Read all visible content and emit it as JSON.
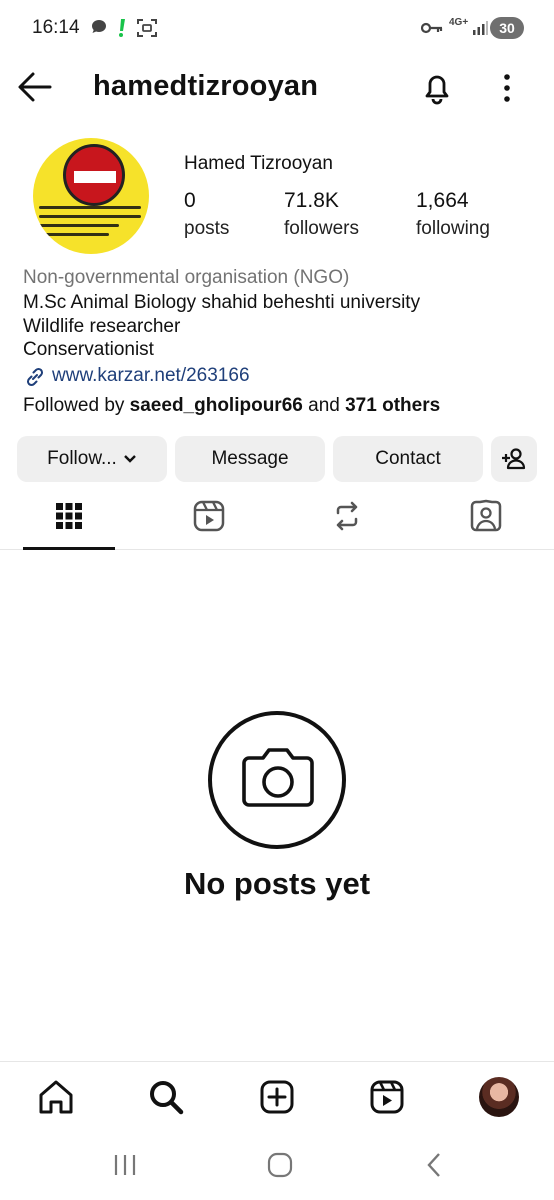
{
  "status_bar": {
    "time": "16:14",
    "network": "4G+",
    "battery": "30",
    "icons": [
      "chat-bubble-icon",
      "alert-icon",
      "screen-record-icon",
      "vpn-key-icon",
      "signal-icon"
    ]
  },
  "header": {
    "username": "hamedtizrooyan",
    "back_icon": "arrow-left-icon",
    "bell_icon": "bell-icon",
    "more_icon": "more-vertical-icon"
  },
  "profile": {
    "display_name": "Hamed Tizrooyan",
    "stats": [
      {
        "value": "0",
        "label": "posts"
      },
      {
        "value": "71.8K",
        "label": "followers"
      },
      {
        "value": "1,664",
        "label": "following"
      }
    ],
    "category": "Non-governmental organisation (NGO)",
    "bio": [
      "M.Sc Animal Biology shahid beheshti university",
      "Wildlife researcher",
      "Conservationist"
    ],
    "link": "www.karzar.net/263166",
    "followed_by_prefix": "Followed by ",
    "followed_by_user": "saeed_gholipour66",
    "followed_by_mid": " and ",
    "followed_by_others": "371 others"
  },
  "actions": {
    "follow": "Follow...",
    "message": "Message",
    "contact": "Contact"
  },
  "tabs": [
    "grid-icon",
    "reels-icon",
    "reposts-icon",
    "tagged-icon"
  ],
  "empty_state": {
    "title": "No posts yet"
  },
  "bottom_nav": [
    "home-icon",
    "search-icon",
    "create-icon",
    "reels-icon",
    "profile-avatar"
  ],
  "colors": {
    "link": "#1f3f7a",
    "muted": "#737373",
    "button_bg": "#efefef",
    "avatar_yellow": "#f6e22a",
    "avatar_red": "#c8161d"
  }
}
